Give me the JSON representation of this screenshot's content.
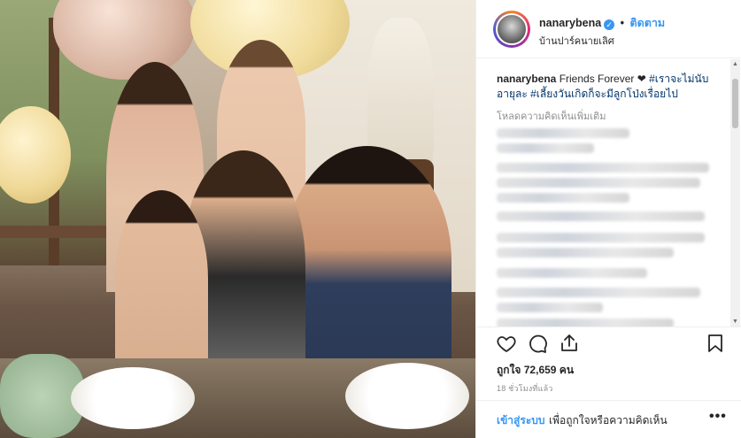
{
  "post": {
    "username": "nanarybena",
    "separator": "•",
    "follow_label": "ติดตาม",
    "location": "บ้านปาร์คนายเลิศ",
    "caption": {
      "username": "nanarybena",
      "text": " Friends Forever ❤",
      "hashtags": " #เราจะไม่นับอายุละ #เลี้ยงวันเกิดก็จะมีลูกโป่งเรื่อยไป"
    },
    "load_more_comments": "โหลดความคิดเห็นเพิ่มเติม",
    "likes": "ถูกใจ 72,659 คน",
    "timestamp": "18 ชั่วโมงที่แล้ว",
    "login_link": "เข้าสู่ระบบ",
    "login_rest": "เพื่อถูกใจหรือความคิดเห็น",
    "more_options": "•••"
  },
  "icons": {
    "verified": "verified-badge-icon",
    "like": "heart-icon",
    "comment": "comment-icon",
    "share": "share-icon",
    "save": "bookmark-icon",
    "more": "more-options-icon"
  },
  "colors": {
    "link": "#3897f0",
    "hashtag": "#003569",
    "muted": "#8e8e8e",
    "text": "#262626"
  }
}
